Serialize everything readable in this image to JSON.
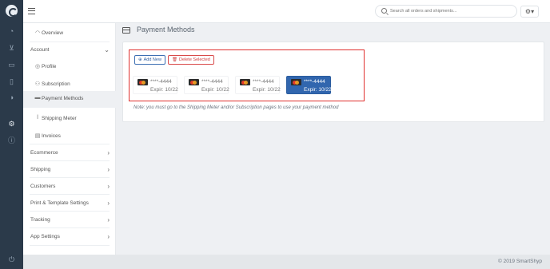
{
  "rail": {
    "icons": [
      "logo-icon",
      "dashboard-icon",
      "cart-icon",
      "truck-icon",
      "document-icon",
      "chart-icon",
      "settings-cogs-icon",
      "info-icon",
      "power-icon"
    ]
  },
  "search": {
    "placeholder": "Search all orders and shipments..."
  },
  "sidebar": {
    "overview": "Overview",
    "account": "Account",
    "profile": "Profile",
    "subscription": "Subscription",
    "payment_methods": "Payment Methods",
    "shipping_meter": "Shipping Meter",
    "invoices": "Invoices",
    "ecommerce": "Ecommerce",
    "shipping": "Shipping",
    "customers": "Customers",
    "print_template": "Print & Template Settings",
    "tracking": "Tracking",
    "app_settings": "App Settings"
  },
  "page": {
    "title": "Payment Methods"
  },
  "toolbar": {
    "add_label": "Add New",
    "delete_label": "Delete Selected"
  },
  "cards": [
    {
      "number": "****-4444",
      "expiry": "Expir: 10/22",
      "selected": false
    },
    {
      "number": "****-4444",
      "expiry": "Expir: 10/22",
      "selected": false
    },
    {
      "number": "****-4444",
      "expiry": "Expir: 10/22",
      "selected": false
    },
    {
      "number": "****-4444",
      "expiry": "Expir: 10/22",
      "selected": true
    }
  ],
  "note": "Note: you must go to the Shipping Meter and/or Subscription pages to use your payment method",
  "footer": {
    "copyright": "© 2019 SmartShyp"
  },
  "colors": {
    "rail": "#2b3a4a",
    "accent": "#3166ae",
    "highlight": "#e0312f"
  }
}
